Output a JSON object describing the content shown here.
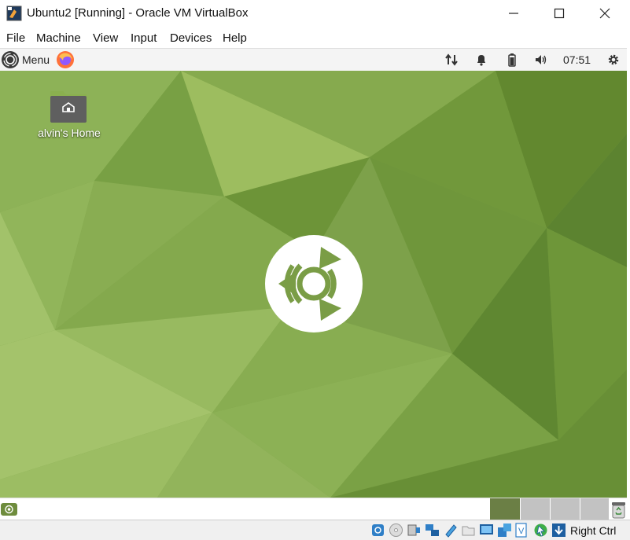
{
  "window": {
    "title": "Ubuntu2 [Running] - Oracle VM VirtualBox"
  },
  "menubar": {
    "items": [
      "File",
      "Machine",
      "View",
      "Input",
      "Devices",
      "Help"
    ]
  },
  "panel": {
    "menu_label": "Menu",
    "clock": "07:51",
    "tray_icons": [
      "network-transfer-icon",
      "notification-bell-icon",
      "battery-icon",
      "volume-icon",
      "settings-gear-icon"
    ]
  },
  "desktop": {
    "home_label": "alvin's Home"
  },
  "statusbar": {
    "host_key": "Right Ctrl"
  },
  "colors": {
    "desktop_green": "#7da14a",
    "panel_bg": "#f4f4f4"
  }
}
